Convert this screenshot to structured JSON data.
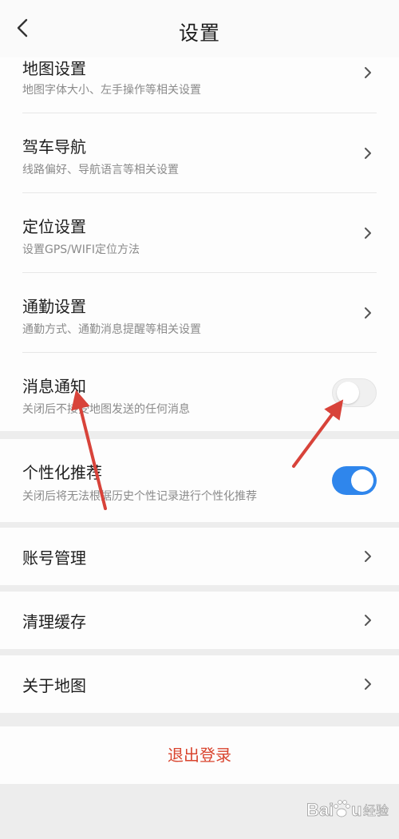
{
  "header": {
    "title": "设置",
    "back_icon": "chevron-left-icon"
  },
  "settings_group": [
    {
      "title": "地图设置",
      "subtitle": "地图字体大小、左手操作等相关设置",
      "control": "chevron"
    },
    {
      "title": "驾车导航",
      "subtitle": "线路偏好、导航语言等相关设置",
      "control": "chevron"
    },
    {
      "title": "定位设置",
      "subtitle": "设置GPS/WIFI定位方法",
      "control": "chevron"
    },
    {
      "title": "通勤设置",
      "subtitle": "通勤方式、通勤消息提醒等相关设置",
      "control": "chevron"
    },
    {
      "title": "消息通知",
      "subtitle": "关闭后不接受地图发送的任何消息",
      "control": "toggle",
      "enabled": false
    }
  ],
  "personalization": {
    "title": "个性化推荐",
    "subtitle": "关闭后将无法根据历史个性记录进行个性化推荐",
    "control": "toggle",
    "enabled": true
  },
  "account": {
    "title": "账号管理"
  },
  "cache": {
    "title": "清理缓存"
  },
  "about": {
    "title": "关于地图"
  },
  "logout": {
    "label": "退出登录"
  },
  "annotations": {
    "arrow_color": "#d8433a",
    "count": 2
  },
  "watermark": {
    "text": "Baidu 经验"
  },
  "colors": {
    "toggle_on": "#2f86ec",
    "toggle_off": "#f0f0f0",
    "logout_text": "#d9452f",
    "background": "#ededed"
  }
}
